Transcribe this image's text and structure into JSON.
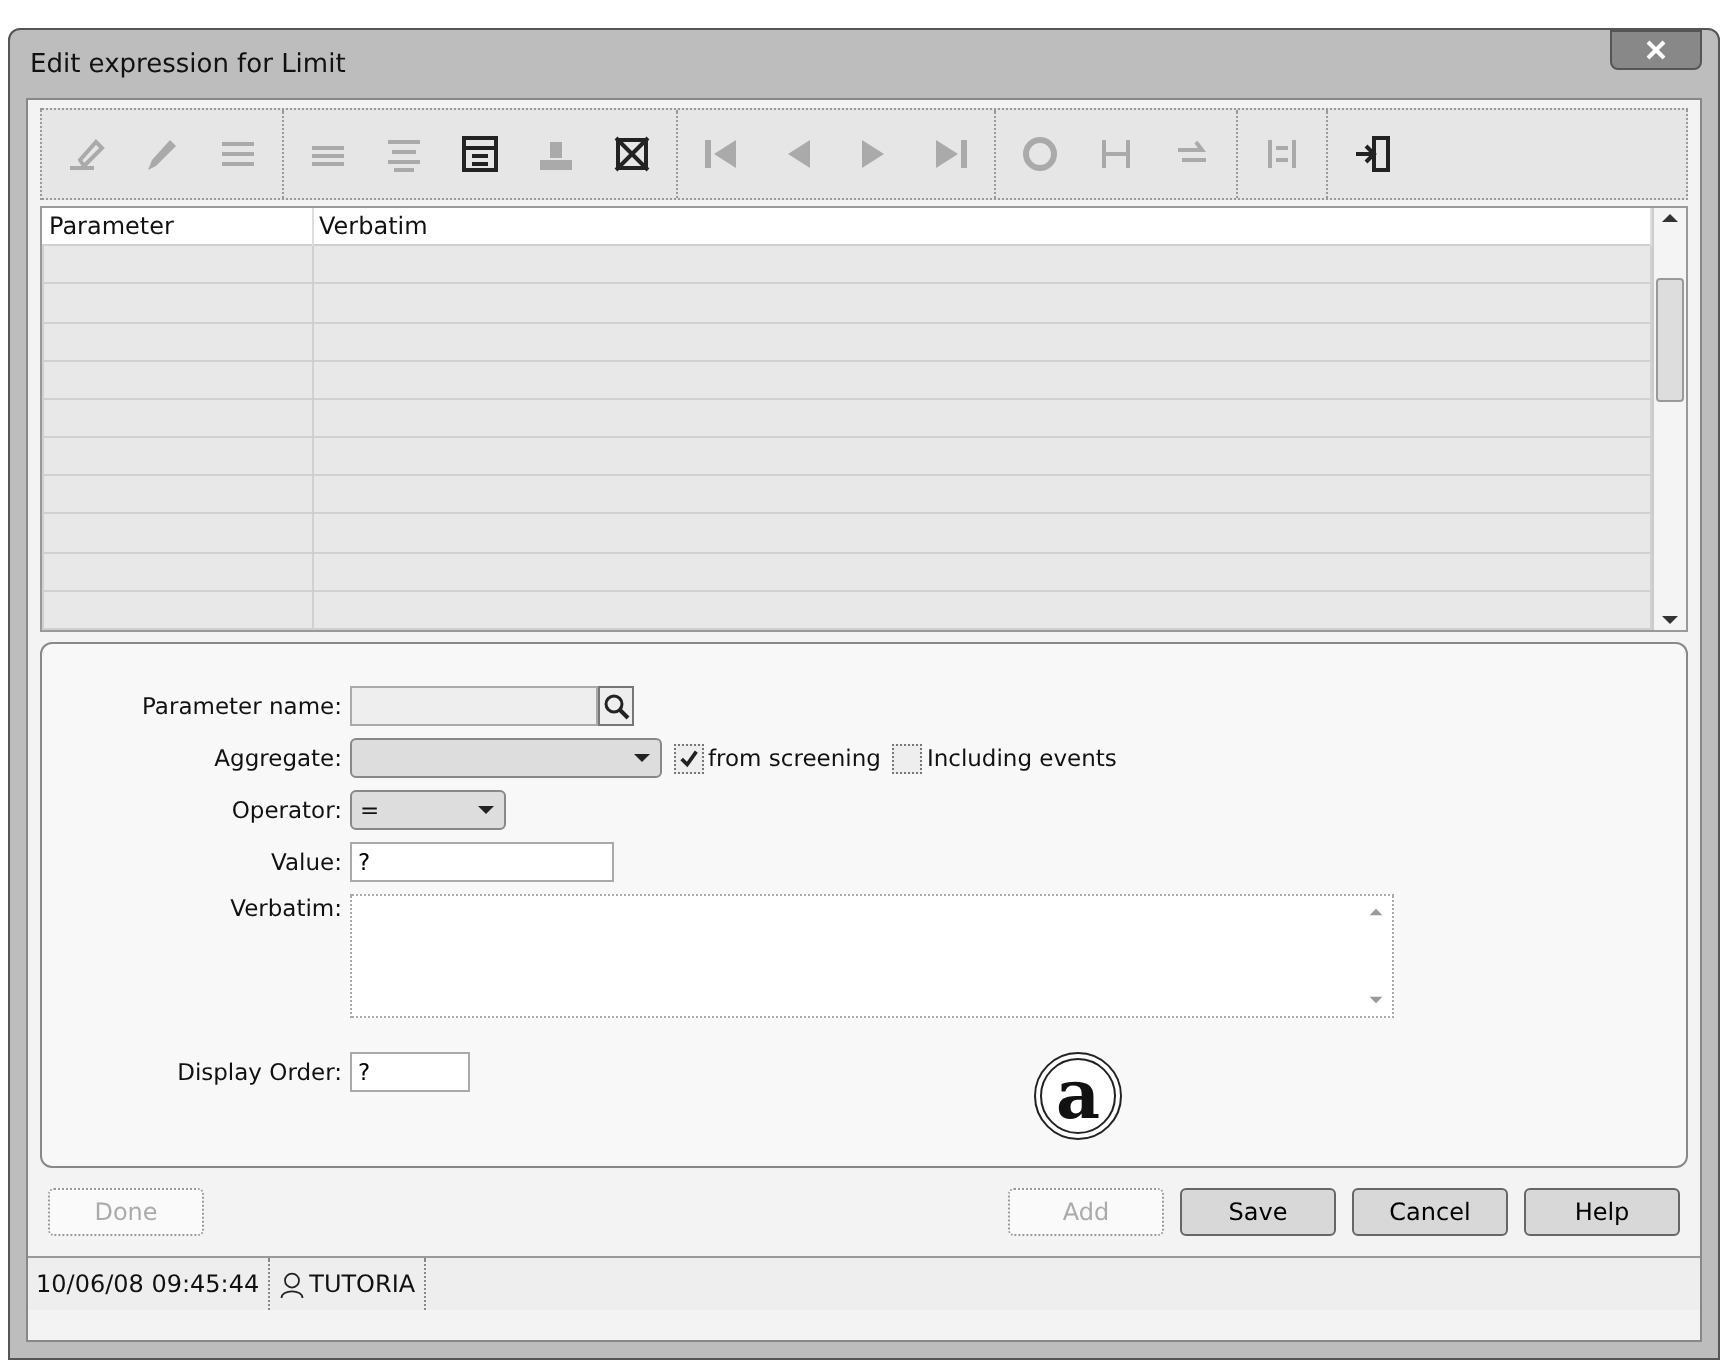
{
  "window": {
    "title": "Edit expression for Limit"
  },
  "toolbar": [
    [
      {
        "disabled": true
      },
      {
        "disabled": true
      },
      {
        "disabled": true
      }
    ],
    [
      {
        "disabled": true
      },
      {
        "disabled": true
      },
      {
        "disabled": false
      },
      {
        "disabled": true
      },
      {
        "disabled": false
      }
    ],
    [
      {
        "disabled": true
      },
      {
        "disabled": true
      },
      {
        "disabled": true
      },
      {
        "disabled": true
      }
    ],
    [
      {
        "disabled": true
      },
      {
        "disabled": true
      },
      {
        "disabled": true
      }
    ],
    [
      {
        "disabled": true
      }
    ],
    [
      {
        "disabled": false
      }
    ]
  ],
  "table": {
    "columns": [
      "Parameter",
      "Verbatim"
    ]
  },
  "form": {
    "parameter_name": {
      "label": "Parameter name:"
    },
    "aggregate": {
      "label": "Aggregate:"
    },
    "options": [
      {
        "label": "from screening",
        "checked": true
      },
      {
        "label": "Including events",
        "checked": false
      }
    ],
    "operator": {
      "label": "Operator:",
      "value": "="
    },
    "value": {
      "label": "Value:",
      "value": "?"
    },
    "verbatim": {
      "label": "Verbatim:"
    },
    "display_order": {
      "label": "Display Order:",
      "value": "?"
    }
  },
  "callout": "a",
  "buttons": [
    {
      "label": "Done",
      "disabled": true
    },
    {
      "label": "Add",
      "disabled": true
    },
    {
      "label": "Save",
      "disabled": false
    },
    {
      "label": "Cancel",
      "disabled": false
    },
    {
      "label": "Help",
      "disabled": false
    }
  ],
  "status_bar": {
    "datetime": "10/06/08 09:45:44",
    "user": "TUTORIA"
  }
}
